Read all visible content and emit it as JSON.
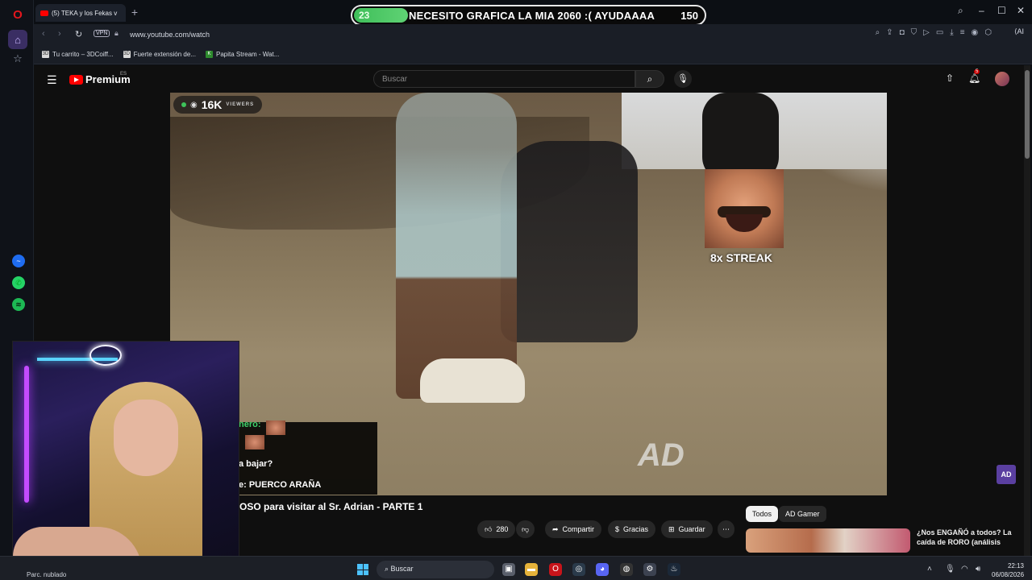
{
  "browser": {
    "tab_title": "(5) TEKA y los Fekas v",
    "url": "www.youtube.com/watch",
    "vpn_label": "VPN",
    "ai_label": "AI",
    "bookmarks": [
      {
        "label": "Tu carrito – 3DCoiff..."
      },
      {
        "label": "Fuerte extensión de..."
      },
      {
        "label": "Papita Stream - Wat..."
      }
    ]
  },
  "donation_goal": {
    "current": "23",
    "text": "NECESITO GRAFICA LA MIA 2060 :( AYUDAAAA",
    "target": "150",
    "progress_fraction": 0.153,
    "fill_color": "#5fd274"
  },
  "youtube": {
    "logo_text": "Premium",
    "region": "ES",
    "search_placeholder": "Buscar",
    "notification_count": "5",
    "video_title_partial": "OSO para visitar al Sr. Adrian - PARTE 1",
    "likes": "280",
    "share_label": "Compartir",
    "thanks_label": "Gracias",
    "save_label": "Guardar",
    "more_label": "⋯",
    "filter_chips": [
      {
        "label": "Todos",
        "active": true
      },
      {
        "label": "AD Gamer",
        "active": false
      }
    ],
    "recommended_title": "¿Nos ENGAÑÓ a todos? La caída de RORO (análisis"
  },
  "stream_overlay": {
    "viewers_count": "16K",
    "viewers_label": "VIEWERS",
    "streak_text": "8x STREAK",
    "watermark": "AD",
    "corner_logo": "AD",
    "chat": [
      {
        "text": "nero:",
        "color": "#3ed16a"
      },
      {
        "text": "a bajar?",
        "color": "#ffffff"
      },
      {
        "text": "e: PUERCO ARAÑA",
        "color": "#ffffff"
      }
    ]
  },
  "taskbar": {
    "weather": "Parc. nublado",
    "search_label": "Buscar",
    "time": "22:13",
    "date": "06/08/2026"
  }
}
